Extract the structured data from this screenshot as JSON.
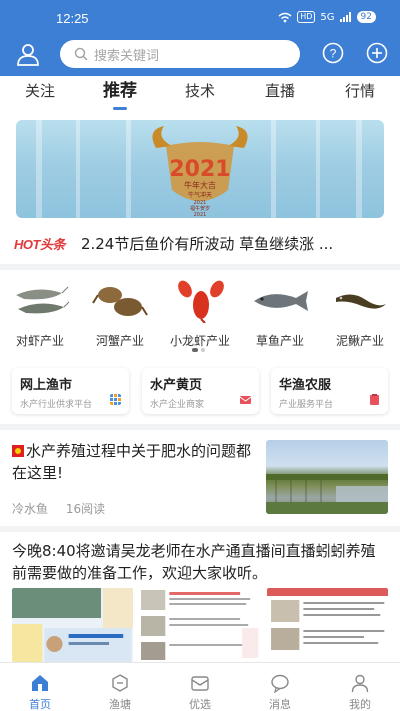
{
  "status": {
    "time": "12:25",
    "hd": "HD",
    "net": "5G",
    "battery": "92"
  },
  "header": {
    "search_placeholder": "搜索关键词"
  },
  "tabs": [
    {
      "label": "关注",
      "active": false
    },
    {
      "label": "推荐",
      "active": true
    },
    {
      "label": "技术",
      "active": false
    },
    {
      "label": "直播",
      "active": false
    },
    {
      "label": "行情",
      "active": false
    }
  ],
  "banner": {
    "year": "2021",
    "line1": "牛年大吉",
    "line2": "牛气冲天",
    "line3": "2021",
    "line4": "福牛贺岁",
    "line5": "2021"
  },
  "news": {
    "tag": "HOT头条",
    "headline": "2.24节后鱼价有所波动 草鱼继续涨 ..."
  },
  "categories": [
    {
      "label": "对虾产业",
      "icon": "shrimp-icon"
    },
    {
      "label": "河蟹产业",
      "icon": "crab-icon"
    },
    {
      "label": "小龙虾产业",
      "icon": "crayfish-icon"
    },
    {
      "label": "草鱼产业",
      "icon": "grass-carp-icon"
    },
    {
      "label": "泥鳅产业",
      "icon": "loach-icon"
    }
  ],
  "services": [
    {
      "title": "网上渔市",
      "subtitle": "水产行业供求平台",
      "color": "#4a8fe0"
    },
    {
      "title": "水产黄页",
      "subtitle": "水产企业商家",
      "color": "#e8505b"
    },
    {
      "title": "华渔农服",
      "subtitle": "产业服务平台",
      "color": "#e8505b"
    }
  ],
  "article1": {
    "title": "水产养殖过程中关于肥水的问题都在这里!",
    "source": "冷水鱼",
    "reads": "16阅读"
  },
  "article2": {
    "title": "今晚8:40将邀请吴龙老师在水产通直播间直播蚓蚓养殖前需要做的准备工作，欢迎大家收听。"
  },
  "bottom_nav": [
    {
      "label": "首页",
      "icon": "home-icon",
      "active": true
    },
    {
      "label": "渔塘",
      "icon": "pond-icon",
      "active": false
    },
    {
      "label": "优选",
      "icon": "mail-icon",
      "active": false
    },
    {
      "label": "消息",
      "icon": "message-icon",
      "active": false
    },
    {
      "label": "我的",
      "icon": "profile-icon",
      "active": false
    }
  ],
  "colors": {
    "brand": "#3d7fd4",
    "hot": "#e03a3a"
  }
}
